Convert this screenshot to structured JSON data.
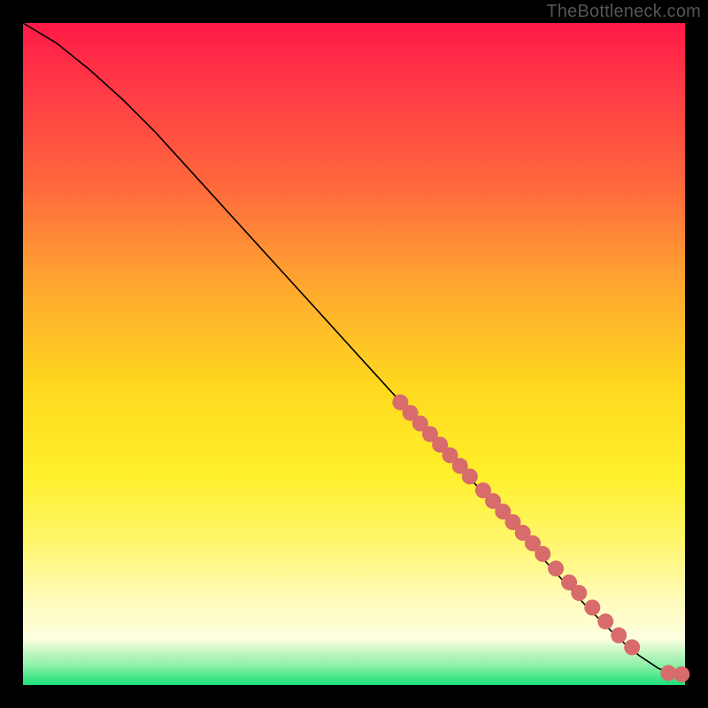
{
  "watermark": "TheBottleneck.com",
  "chart_data": {
    "type": "line",
    "title": "",
    "xlabel": "",
    "ylabel": "",
    "xlim": [
      0,
      100
    ],
    "ylim": [
      0,
      100
    ],
    "background_gradient": {
      "direction": "vertical",
      "stops": [
        {
          "pos": 0,
          "color": "#ff1a47"
        },
        {
          "pos": 25,
          "color": "#ff6a3c"
        },
        {
          "pos": 55,
          "color": "#ffd91f"
        },
        {
          "pos": 78,
          "color": "#fff66a"
        },
        {
          "pos": 93,
          "color": "#fdffe0"
        },
        {
          "pos": 100,
          "color": "#19e076"
        }
      ]
    },
    "series": [
      {
        "name": "bottleneck-curve",
        "kind": "line",
        "color": "#000000",
        "x": [
          0,
          5,
          10,
          15,
          20,
          25,
          30,
          35,
          40,
          45,
          50,
          55,
          60,
          65,
          70,
          75,
          80,
          85,
          90,
          93,
          96,
          98,
          100
        ],
        "y": [
          100,
          97,
          93,
          88.5,
          83.5,
          78,
          72.5,
          67,
          61.5,
          56,
          50.5,
          45,
          39.5,
          34,
          28.5,
          23,
          17.5,
          12,
          7,
          4.5,
          2.5,
          1.7,
          1.5
        ]
      },
      {
        "name": "highlighted-points",
        "kind": "scatter",
        "color": "#d86b6b",
        "radius": 9,
        "x": [
          57,
          58.5,
          60,
          61.5,
          63,
          64.5,
          66,
          67.5,
          69.5,
          71,
          72.5,
          74,
          75.5,
          77,
          78.5,
          80.5,
          82.5,
          84,
          86,
          88,
          90,
          92,
          97.5,
          99.5
        ],
        "y": [
          42.7,
          41.1,
          39.5,
          37.9,
          36.3,
          34.7,
          33.1,
          31.5,
          29.4,
          27.8,
          26.2,
          24.6,
          23.0,
          21.4,
          19.8,
          17.6,
          15.5,
          13.9,
          11.7,
          9.6,
          7.5,
          5.7,
          1.8,
          1.6
        ]
      }
    ]
  }
}
